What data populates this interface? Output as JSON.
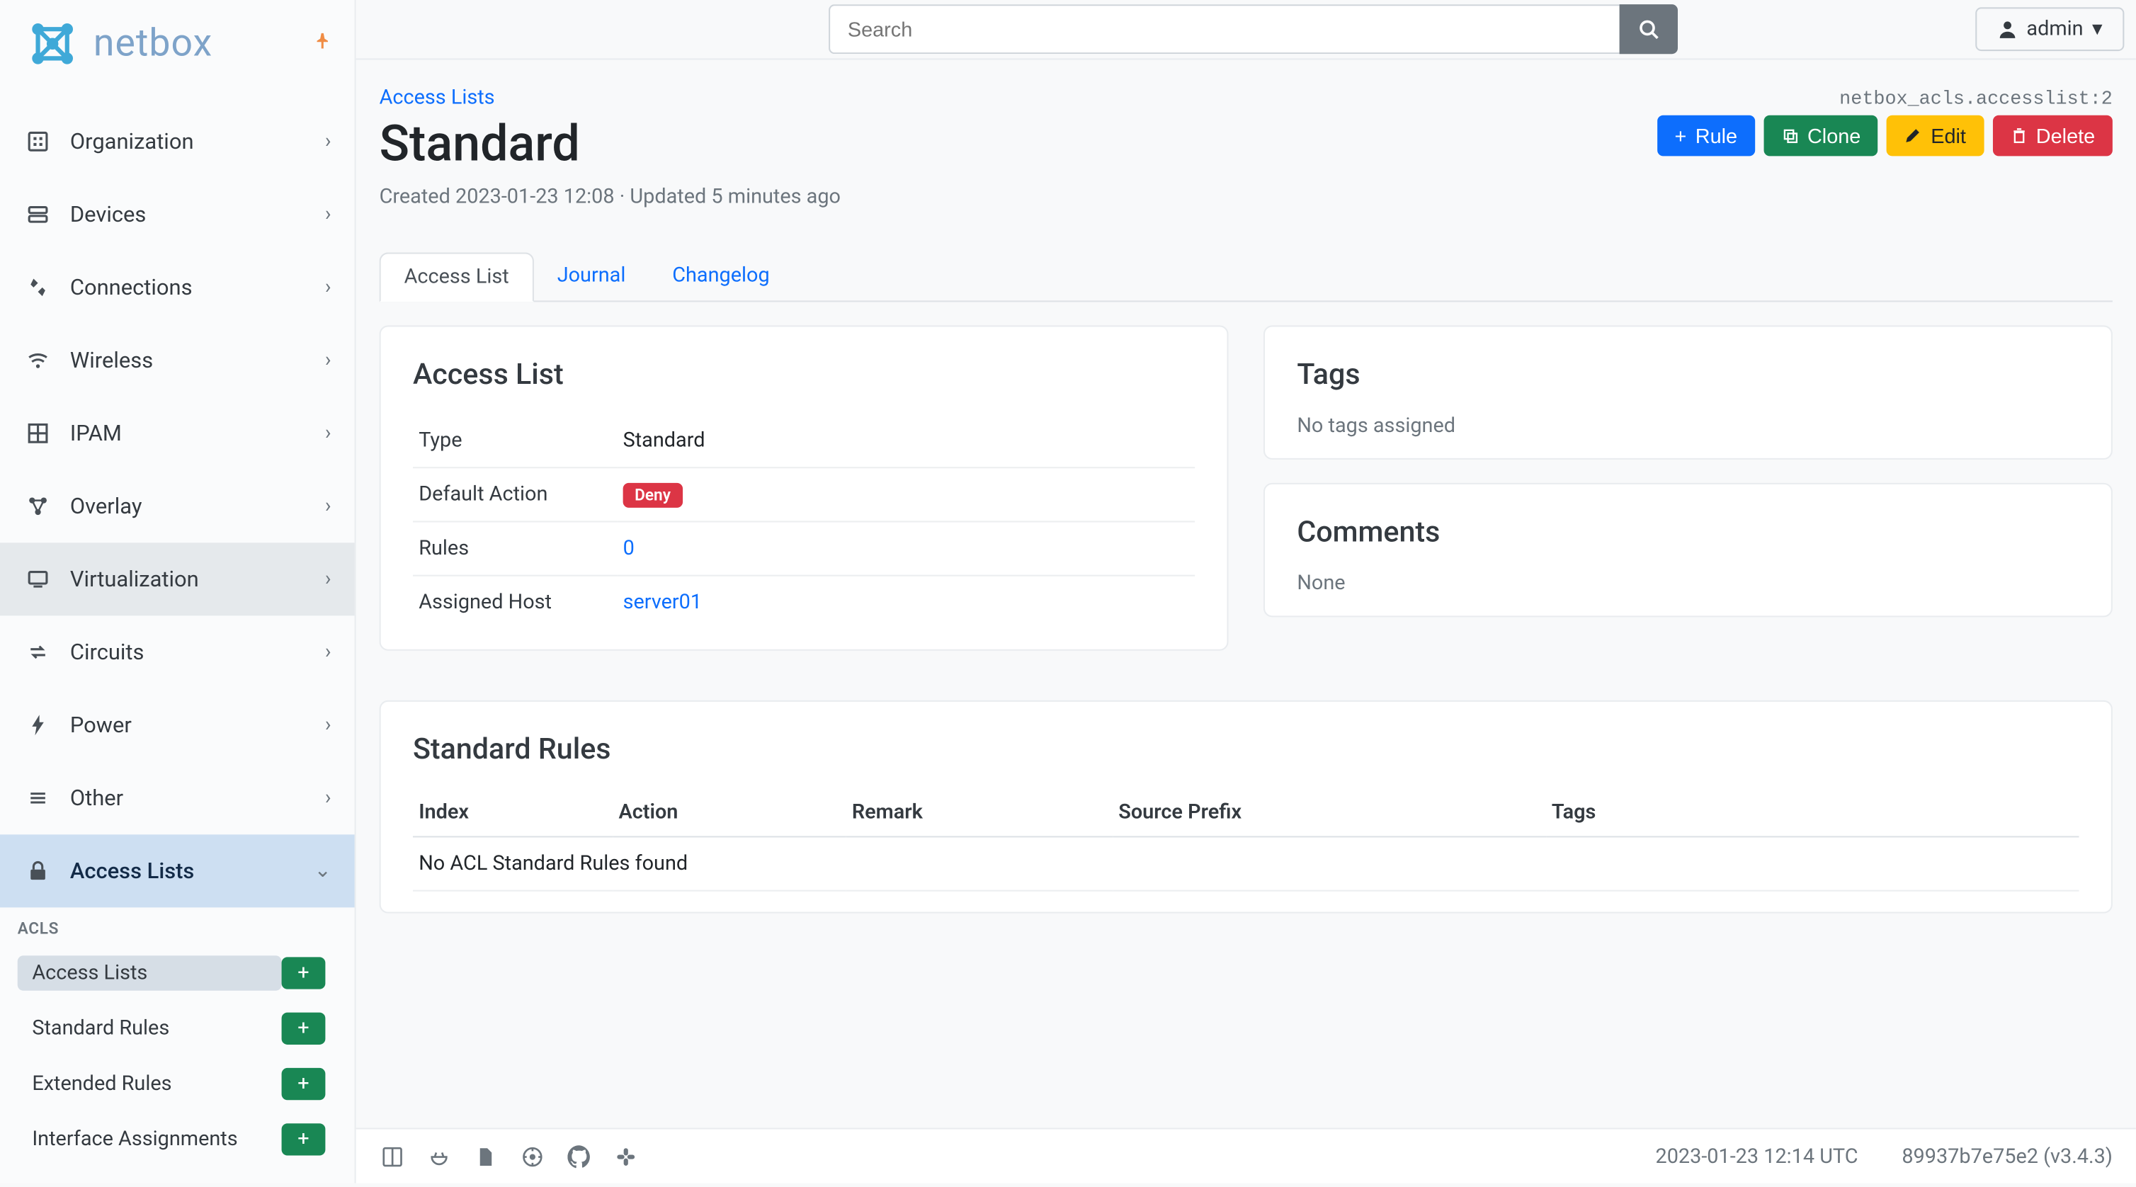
{
  "brand": "netbox",
  "search": {
    "placeholder": "Search"
  },
  "user": {
    "name": "admin"
  },
  "sidebar": {
    "items": [
      {
        "label": "Organization"
      },
      {
        "label": "Devices"
      },
      {
        "label": "Connections"
      },
      {
        "label": "Wireless"
      },
      {
        "label": "IPAM"
      },
      {
        "label": "Overlay"
      },
      {
        "label": "Virtualization"
      },
      {
        "label": "Circuits"
      },
      {
        "label": "Power"
      },
      {
        "label": "Other"
      }
    ],
    "plugin": {
      "header": "Access Lists",
      "section_title": "ACLS",
      "links": [
        {
          "label": "Access Lists"
        },
        {
          "label": "Standard Rules"
        },
        {
          "label": "Extended Rules"
        },
        {
          "label": "Interface Assignments"
        }
      ]
    }
  },
  "breadcrumb": {
    "root": "Access Lists"
  },
  "object_path": "netbox_acls.accesslist:2",
  "page_title": "Standard",
  "meta": "Created 2023-01-23 12:08 · Updated 5 minutes ago",
  "actions": {
    "rule": "Rule",
    "clone": "Clone",
    "edit": "Edit",
    "delete": "Delete"
  },
  "tabs": {
    "access_list": "Access List",
    "journal": "Journal",
    "changelog": "Changelog"
  },
  "panels": {
    "details": {
      "title": "Access List",
      "rows": {
        "type_label": "Type",
        "type_value": "Standard",
        "default_action_label": "Default Action",
        "default_action_value": "Deny",
        "rules_label": "Rules",
        "rules_value": "0",
        "assigned_host_label": "Assigned Host",
        "assigned_host_value": "server01"
      }
    },
    "tags": {
      "title": "Tags",
      "empty": "No tags assigned"
    },
    "comments": {
      "title": "Comments",
      "empty": "None"
    },
    "rules": {
      "title": "Standard Rules",
      "columns": {
        "index": "Index",
        "action": "Action",
        "remark": "Remark",
        "source_prefix": "Source Prefix",
        "tags": "Tags"
      },
      "empty": "No ACL Standard Rules found"
    }
  },
  "footer": {
    "timestamp": "2023-01-23 12:14 UTC",
    "version": "89937b7e75e2 (v3.4.3)"
  }
}
